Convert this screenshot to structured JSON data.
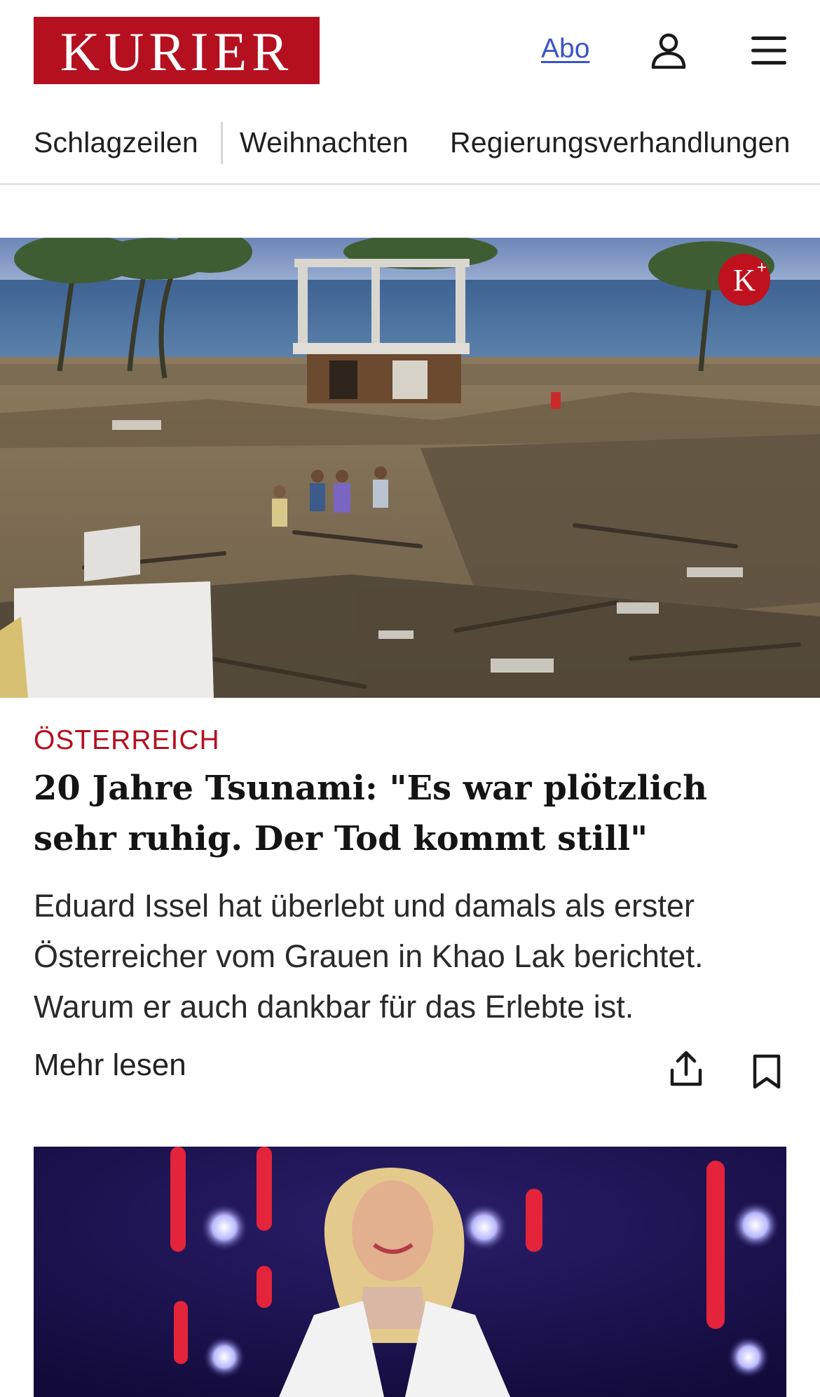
{
  "header": {
    "logo_text": "KURIER",
    "brand_color": "#b5101f",
    "abo_label": "Abo",
    "user_icon": "user-icon",
    "menu_icon": "hamburger-menu-icon"
  },
  "nav": {
    "items": [
      {
        "label": "Schlagzeilen"
      },
      {
        "label": "Weihnachten"
      },
      {
        "label": "Regierungsverhandlungen"
      }
    ]
  },
  "hero": {
    "image_description_icon": "tsunami-devastation-photo",
    "badge_text": "K",
    "badge_plus": "+"
  },
  "article": {
    "category": "ÖSTERREICH",
    "headline": "20 Jahre Tsunami: \"Es war plötzlich sehr ruhig. Der Tod kommt still\"",
    "teaser": "Eduard Issel hat überlebt und damals als erster Österreicher vom Grauen in Khao Lak berichtet. Warum er auch dankbar für das Erlebte ist.",
    "more_label": "Mehr lesen",
    "share_icon": "share-icon",
    "bookmark_icon": "bookmark-icon"
  },
  "second_card": {
    "image_icon": "stage-performer-photo"
  }
}
